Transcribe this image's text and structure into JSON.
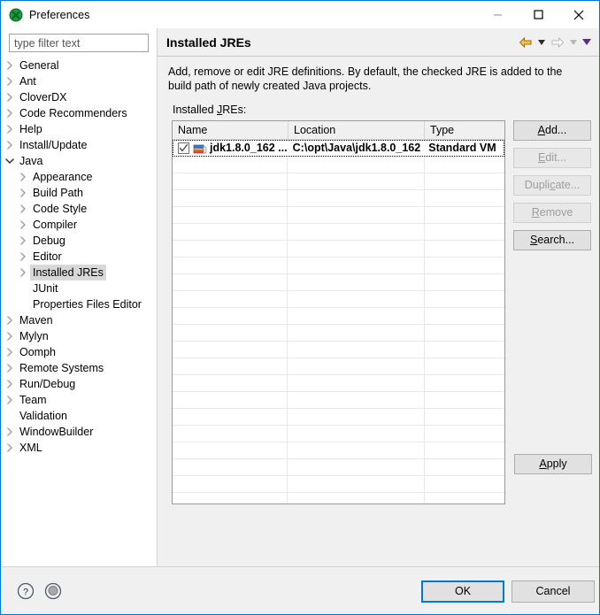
{
  "window": {
    "title": "Preferences",
    "icon": "preferences-icon",
    "controls": {
      "minimize": "minimize-icon",
      "maximize": "maximize-icon",
      "close": "close-icon"
    }
  },
  "sidebar": {
    "filter": {
      "placeholder": "type filter text",
      "value": ""
    },
    "items": [
      {
        "label": "General",
        "level": 0,
        "expander": "collapsed"
      },
      {
        "label": "Ant",
        "level": 0,
        "expander": "collapsed"
      },
      {
        "label": "CloverDX",
        "level": 0,
        "expander": "collapsed"
      },
      {
        "label": "Code Recommenders",
        "level": 0,
        "expander": "collapsed"
      },
      {
        "label": "Help",
        "level": 0,
        "expander": "collapsed"
      },
      {
        "label": "Install/Update",
        "level": 0,
        "expander": "collapsed"
      },
      {
        "label": "Java",
        "level": 0,
        "expander": "expanded"
      },
      {
        "label": "Appearance",
        "level": 1,
        "expander": "collapsed"
      },
      {
        "label": "Build Path",
        "level": 1,
        "expander": "collapsed"
      },
      {
        "label": "Code Style",
        "level": 1,
        "expander": "collapsed"
      },
      {
        "label": "Compiler",
        "level": 1,
        "expander": "collapsed"
      },
      {
        "label": "Debug",
        "level": 1,
        "expander": "collapsed"
      },
      {
        "label": "Editor",
        "level": 1,
        "expander": "collapsed"
      },
      {
        "label": "Installed JREs",
        "level": 1,
        "expander": "collapsed",
        "selected": true
      },
      {
        "label": "JUnit",
        "level": 1,
        "expander": "none"
      },
      {
        "label": "Properties Files Editor",
        "level": 1,
        "expander": "none"
      },
      {
        "label": "Maven",
        "level": 0,
        "expander": "collapsed"
      },
      {
        "label": "Mylyn",
        "level": 0,
        "expander": "collapsed"
      },
      {
        "label": "Oomph",
        "level": 0,
        "expander": "collapsed"
      },
      {
        "label": "Remote Systems",
        "level": 0,
        "expander": "collapsed"
      },
      {
        "label": "Run/Debug",
        "level": 0,
        "expander": "collapsed"
      },
      {
        "label": "Team",
        "level": 0,
        "expander": "collapsed"
      },
      {
        "label": "Validation",
        "level": 0,
        "expander": "none"
      },
      {
        "label": "WindowBuilder",
        "level": 0,
        "expander": "collapsed"
      },
      {
        "label": "XML",
        "level": 0,
        "expander": "collapsed"
      }
    ]
  },
  "page": {
    "title": "Installed JREs",
    "nav": {
      "back_icon": "back-arrow-icon",
      "back_caret_icon": "chevron-down-icon",
      "forward_icon": "forward-arrow-icon",
      "forward_caret_icon": "chevron-down-icon",
      "menu_caret_icon": "chevron-down-icon"
    },
    "description": "Add, remove or edit JRE definitions. By default, the checked JRE is added to the build path of newly created Java projects.",
    "table_label_pre": "Installed ",
    "table_label_key": "J",
    "table_label_post": "REs:"
  },
  "table": {
    "columns": [
      "Name",
      "Location",
      "Type"
    ],
    "rows": [
      {
        "checked": true,
        "icon": "jre-library-icon",
        "name": "jdk1.8.0_162 ...",
        "location": "C:\\opt\\Java\\jdk1.8.0_162",
        "type": "Standard VM",
        "selected": true
      }
    ],
    "empty_row_count": 21
  },
  "side_buttons": [
    {
      "pre": "",
      "key": "A",
      "post": "dd...",
      "label": "Add...",
      "enabled": true
    },
    {
      "pre": "",
      "key": "E",
      "post": "dit...",
      "label": "Edit...",
      "enabled": false
    },
    {
      "pre": "Dupli",
      "key": "c",
      "post": "ate...",
      "label": "Duplicate...",
      "enabled": false
    },
    {
      "pre": "",
      "key": "R",
      "post": "emove",
      "label": "Remove",
      "enabled": false
    },
    {
      "pre": "",
      "key": "S",
      "post": "earch...",
      "label": "Search...",
      "enabled": true
    }
  ],
  "apply": {
    "pre": "",
    "key": "A",
    "post": "pply",
    "label": "Apply"
  },
  "footer": {
    "help_icon": "help-icon",
    "restore_icon": "restore-defaults-icon",
    "ok_label": "OK",
    "cancel_label": "Cancel"
  },
  "colors": {
    "window_border": "#0078d7",
    "focus_blue": "#0078d7",
    "panel_bg": "#f0f0f0",
    "white": "#ffffff",
    "selection_gray": "#d8d8d8",
    "back_arrow": "#e8b13a",
    "forward_arrow": "#c9c9c9",
    "menu_caret": "#5a2d82",
    "app_icon_green": "#1a9e3e"
  }
}
